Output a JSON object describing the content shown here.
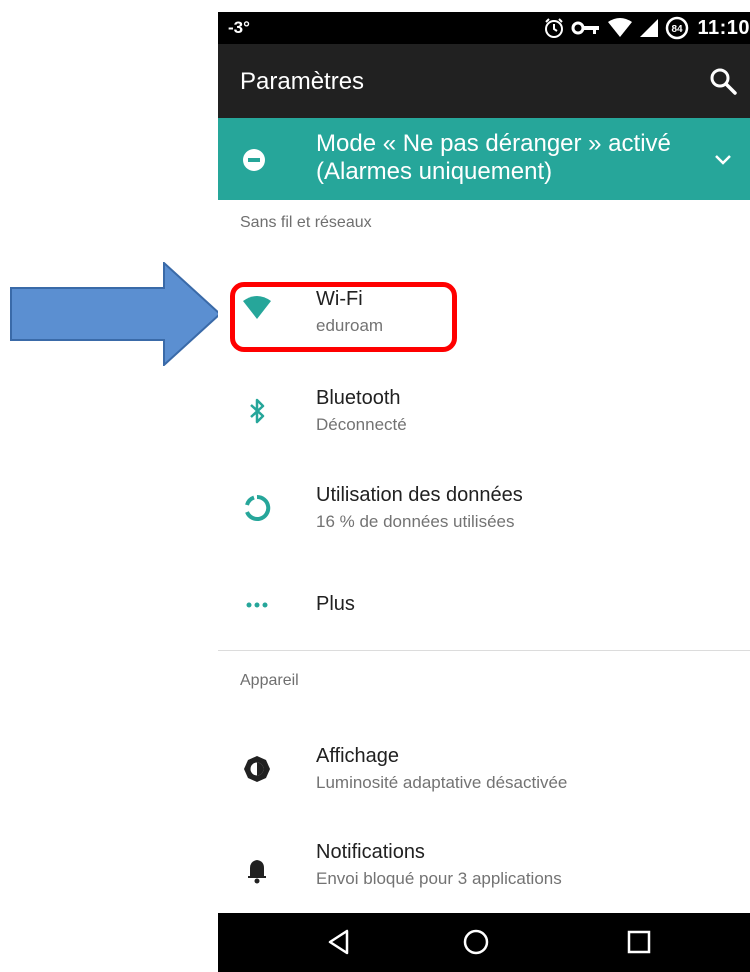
{
  "status_bar": {
    "temperature": "-3°",
    "icons": [
      "alarm-icon",
      "vpn-key-icon",
      "wifi-signal-icon",
      "cell-signal-icon",
      "battery-84-icon"
    ],
    "battery_level": "84",
    "time": "11:10"
  },
  "toolbar": {
    "title": "Paramètres",
    "search_icon": "search-icon"
  },
  "dnd_banner": {
    "icon": "do-not-disturb-icon",
    "text": "Mode « Ne pas déranger » activé (Alarmes uniquement)",
    "expand_icon": "chevron-down-icon"
  },
  "sections": {
    "wireless": "Sans fil et réseaux",
    "device": "Appareil"
  },
  "items": {
    "wifi": {
      "icon": "wifi-icon",
      "title": "Wi-Fi",
      "subtitle": "eduroam"
    },
    "bluetooth": {
      "icon": "bluetooth-icon",
      "title": "Bluetooth",
      "subtitle": "Déconnecté"
    },
    "data_usage": {
      "icon": "data-usage-icon",
      "title": "Utilisation des données",
      "subtitle": "16 % de données utilisées"
    },
    "more": {
      "icon": "more-dots-icon",
      "title": "Plus"
    },
    "display": {
      "icon": "brightness-icon",
      "title": "Affichage",
      "subtitle": "Luminosité adaptative désactivée"
    },
    "notifications": {
      "icon": "bell-icon",
      "title": "Notifications",
      "subtitle": "Envoi bloqué pour 3 applications"
    }
  },
  "nav_bar": {
    "back": "back-triangle-icon",
    "home": "home-circle-icon",
    "recents": "recents-square-icon"
  },
  "colors": {
    "accent": "#26a69a",
    "toolbar": "#212121",
    "highlight": "#ff0000",
    "arrow_fill": "#5b8fd1",
    "arrow_stroke": "#3a6aa8"
  }
}
